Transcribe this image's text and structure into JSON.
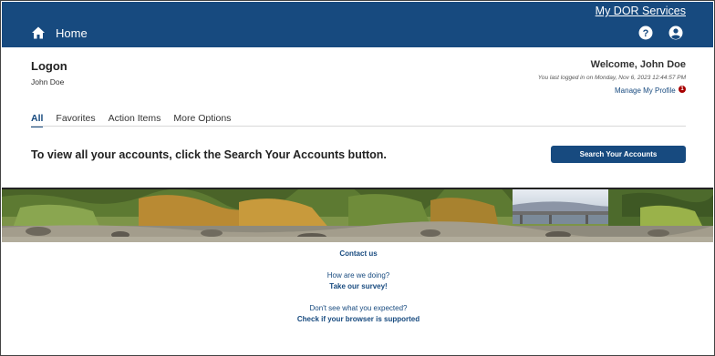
{
  "header": {
    "services_link": "My DOR Services",
    "home_label": "Home",
    "help_icon": "question-circle-icon",
    "account_icon": "user-circle-icon",
    "colors": {
      "bar": "#174a7f",
      "text": "#ffffff"
    }
  },
  "page": {
    "title": "Logon",
    "username": "John Doe",
    "welcome": "Welcome, John Doe",
    "last_login": "You last logged in on Monday, Nov 6, 2023 12:44:57 PM",
    "manage_profile": "Manage My Profile",
    "notification_count": "1"
  },
  "tabs": [
    {
      "label": "All",
      "active": true
    },
    {
      "label": "Favorites",
      "active": false
    },
    {
      "label": "Action Items",
      "active": false
    },
    {
      "label": "More Options",
      "active": false
    }
  ],
  "content": {
    "instruction": "To view all your accounts, click the Search Your Accounts button.",
    "search_button": "Search Your Accounts"
  },
  "footer": {
    "contact": "Contact us",
    "survey_question": "How are we doing?",
    "survey_link": "Take our survey!",
    "browser_question": "Don't see what you expected?",
    "browser_link": "Check if your browser is supported"
  },
  "accent_color": "#174a7f",
  "notification_color": "#a80000"
}
